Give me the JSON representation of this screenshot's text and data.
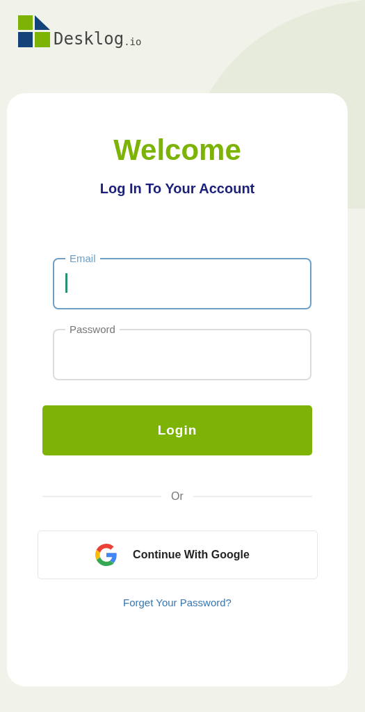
{
  "logo": {
    "brand": "Desklog",
    "suffix": ".io"
  },
  "heading": "Welcome",
  "subheading": "Log In To Your Account",
  "fields": [
    {
      "label": "Email",
      "focused": true
    },
    {
      "label": "Password",
      "focused": false
    }
  ],
  "login_button": "Login",
  "divider": "Or",
  "google_button": "Continue With Google",
  "forgot_link": "Forget Your Password?"
}
